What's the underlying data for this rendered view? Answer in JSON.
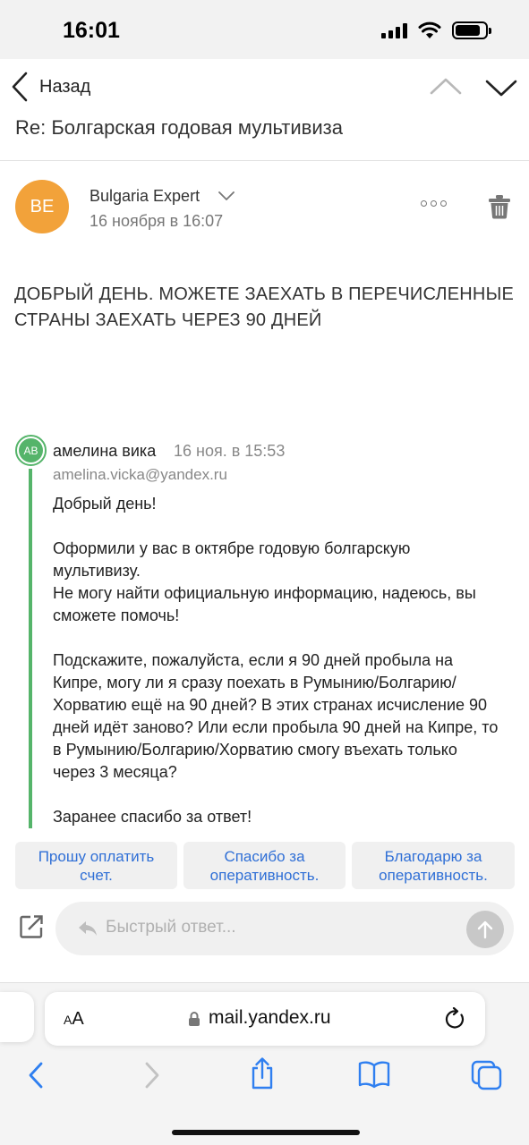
{
  "status_bar": {
    "time": "16:01",
    "battery_level": 0.85
  },
  "nav": {
    "back_label": "Назад"
  },
  "email": {
    "subject": "Re: Болгарская годовая мультивиза",
    "sender": {
      "initials": "BE",
      "name": "Bulgaria Expert",
      "date": "16 ноября в 16:07",
      "avatar_color": "#f2a23a"
    },
    "body": "ДОБРЫЙ ДЕНЬ. МОЖЕТЕ ЗАЕХАТЬ В ПЕРЕЧИСЛЕННЫЕ СТРАНЫ ЗАЕХАТЬ ЧЕРЕЗ 90 ДНЕЙ",
    "quoted": {
      "initials": "АВ",
      "name": "амелина вика",
      "date": "16 ноя. в 15:53",
      "email": "amelina.vicka@yandex.ru",
      "accent_color": "#55b46a",
      "paragraphs": [
        "Добрый день!",
        "Оформили у вас в октябре годовую болгарскую мультивизу.\nНе могу найти официальную информацию, надеюсь, вы сможете помочь!",
        "Подскажите, пожалуйста, если я 90 дней пробыла на Кипре, могу ли я сразу поехать в Румынию/Болгарию/Хорватию ещё на 90 дней? В этих странах исчисление 90 дней идёт заново? Или если пробыла 90 дней на Кипре, то в Румынию/Болгарию/Хорватию смогу въехать только через 3 месяца?",
        "Заранее спасибо за ответ!"
      ]
    }
  },
  "quick_replies": [
    "Прошу оплатить счет.",
    "Спасибо за оперативность.",
    "Благодарю за оперативность."
  ],
  "quick_reply_input": {
    "placeholder": "Быстрый ответ...",
    "value": ""
  },
  "browser": {
    "text_size_label_small": "A",
    "text_size_label_large": "A",
    "url": "mail.yandex.ru"
  },
  "colors": {
    "link": "#2f6fd6",
    "accent_green": "#55b46a",
    "avatar_orange": "#f2a23a"
  }
}
